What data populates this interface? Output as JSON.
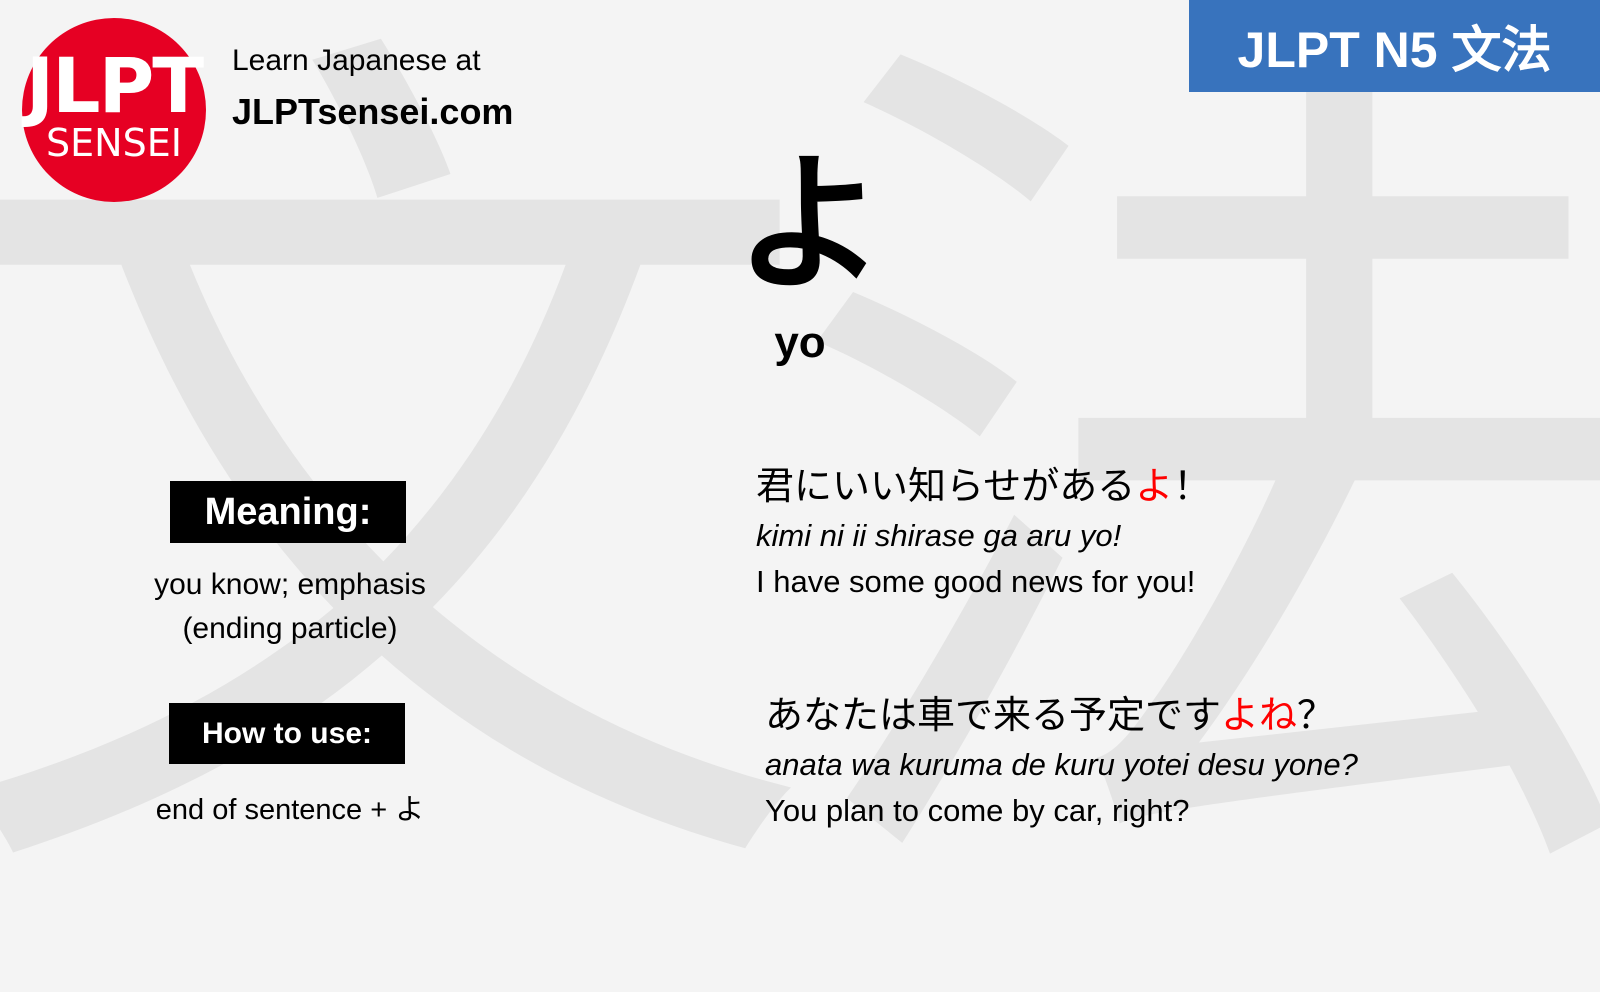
{
  "background": {
    "watermark_chars": [
      "文",
      "法"
    ],
    "color": "#f4f4f4",
    "watermark_color": "#e4e4e4"
  },
  "brand": {
    "logo_top": "JLPT",
    "logo_bottom": "SENSEI",
    "logo_color": "#e60023",
    "tagline": "Learn Japanese at",
    "site": "JLPTsensei.com"
  },
  "badge": {
    "label": "JLPT N5 文法",
    "color": "#3873bd"
  },
  "grammar": {
    "kana": "よ",
    "romaji": "yo"
  },
  "meaning": {
    "label": "Meaning:",
    "lines": [
      "you know; emphasis",
      "(ending particle)"
    ]
  },
  "how_to_use": {
    "label": "How to use:",
    "text": "end of sentence + よ"
  },
  "examples": [
    {
      "jp_before": "君にいい知らせがある",
      "jp_highlight": "よ",
      "jp_after": "！",
      "romaji": "kimi ni ii shirase ga aru yo!",
      "english": "I have some good news for you!"
    },
    {
      "jp_before": "あなたは車で来る予定です",
      "jp_highlight": "よね",
      "jp_after": "？",
      "romaji": "anata wa kuruma de kuru yotei desu yone?",
      "english": "You plan to come by car, right?"
    }
  ],
  "highlight_color": "#ff0000"
}
